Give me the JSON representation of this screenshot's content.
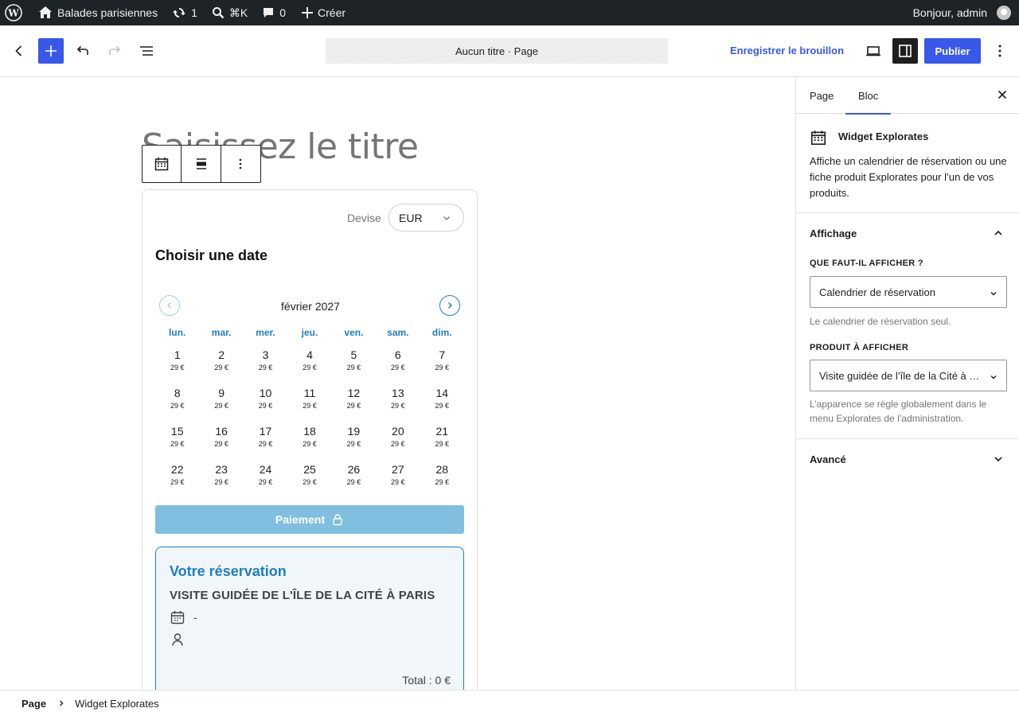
{
  "admin_bar": {
    "site_name": "Balades parisiennes",
    "updates_count": "1",
    "command_shortcut": "⌘K",
    "comments_count": "0",
    "new_label": "Créer",
    "greeting": "Bonjour, admin"
  },
  "header": {
    "document_title": "Aucun titre · Page",
    "save_draft_label": "Enregistrer le brouillon",
    "publish_label": "Publier"
  },
  "canvas": {
    "title_placeholder": "Saisissez le titre"
  },
  "widget": {
    "currency_label": "Devise",
    "currency_value": "EUR",
    "choose_date_heading": "Choisir une date",
    "month_label": "février 2027",
    "weekdays": [
      "lun.",
      "mar.",
      "mer.",
      "jeu.",
      "ven.",
      "sam.",
      "dim."
    ],
    "days": [
      {
        "num": "1",
        "price": "29 €"
      },
      {
        "num": "2",
        "price": "29 €"
      },
      {
        "num": "3",
        "price": "29 €"
      },
      {
        "num": "4",
        "price": "29 €"
      },
      {
        "num": "5",
        "price": "29 €"
      },
      {
        "num": "6",
        "price": "29 €"
      },
      {
        "num": "7",
        "price": "29 €"
      },
      {
        "num": "8",
        "price": "29 €"
      },
      {
        "num": "9",
        "price": "29 €"
      },
      {
        "num": "10",
        "price": "29 €"
      },
      {
        "num": "11",
        "price": "29 €"
      },
      {
        "num": "12",
        "price": "29 €"
      },
      {
        "num": "13",
        "price": "29 €"
      },
      {
        "num": "14",
        "price": "29 €"
      },
      {
        "num": "15",
        "price": "29 €"
      },
      {
        "num": "16",
        "price": "29 €"
      },
      {
        "num": "17",
        "price": "29 €"
      },
      {
        "num": "18",
        "price": "29 €"
      },
      {
        "num": "19",
        "price": "29 €"
      },
      {
        "num": "20",
        "price": "29 €"
      },
      {
        "num": "21",
        "price": "29 €"
      },
      {
        "num": "22",
        "price": "29 €"
      },
      {
        "num": "23",
        "price": "29 €"
      },
      {
        "num": "24",
        "price": "29 €"
      },
      {
        "num": "25",
        "price": "29 €"
      },
      {
        "num": "26",
        "price": "29 €"
      },
      {
        "num": "27",
        "price": "29 €"
      },
      {
        "num": "28",
        "price": "29 €"
      }
    ],
    "payment_label": "Paiement",
    "booking": {
      "title": "Votre réservation",
      "product": "VISITE GUIDÉE DE L'ÎLE DE LA CITÉ À PARIS",
      "date_value": "-",
      "total": "Total : 0 €"
    }
  },
  "sidebar": {
    "tabs": [
      "Page",
      "Bloc"
    ],
    "active_tab": "Bloc",
    "block_title": "Widget Explorates",
    "block_description": "Affiche un calendrier de réservation ou une fiche produit Explorates pour l’un de vos produits.",
    "panel_display": {
      "title": "Affichage",
      "what_label": "Que faut-il afficher ?",
      "what_value": "Calendrier de réservation",
      "what_help": "Le calendrier de réservation seul.",
      "product_label": "Produit à afficher",
      "product_value": "Visite guidée de l’île de la Cité à Paris",
      "product_help": "L’apparence se règle globalement dans le menu Explorates de l’administration."
    },
    "panel_advanced": {
      "title": "Avancé"
    }
  },
  "footer": {
    "breadcrumb_root": "Page",
    "breadcrumb_current": "Widget Explorates"
  },
  "colors": {
    "admin_bar_bg": "#1d2327",
    "accent": "#3858e9",
    "widget_blue": "#1d7ec2",
    "payment_disabled": "#80bfe0"
  }
}
